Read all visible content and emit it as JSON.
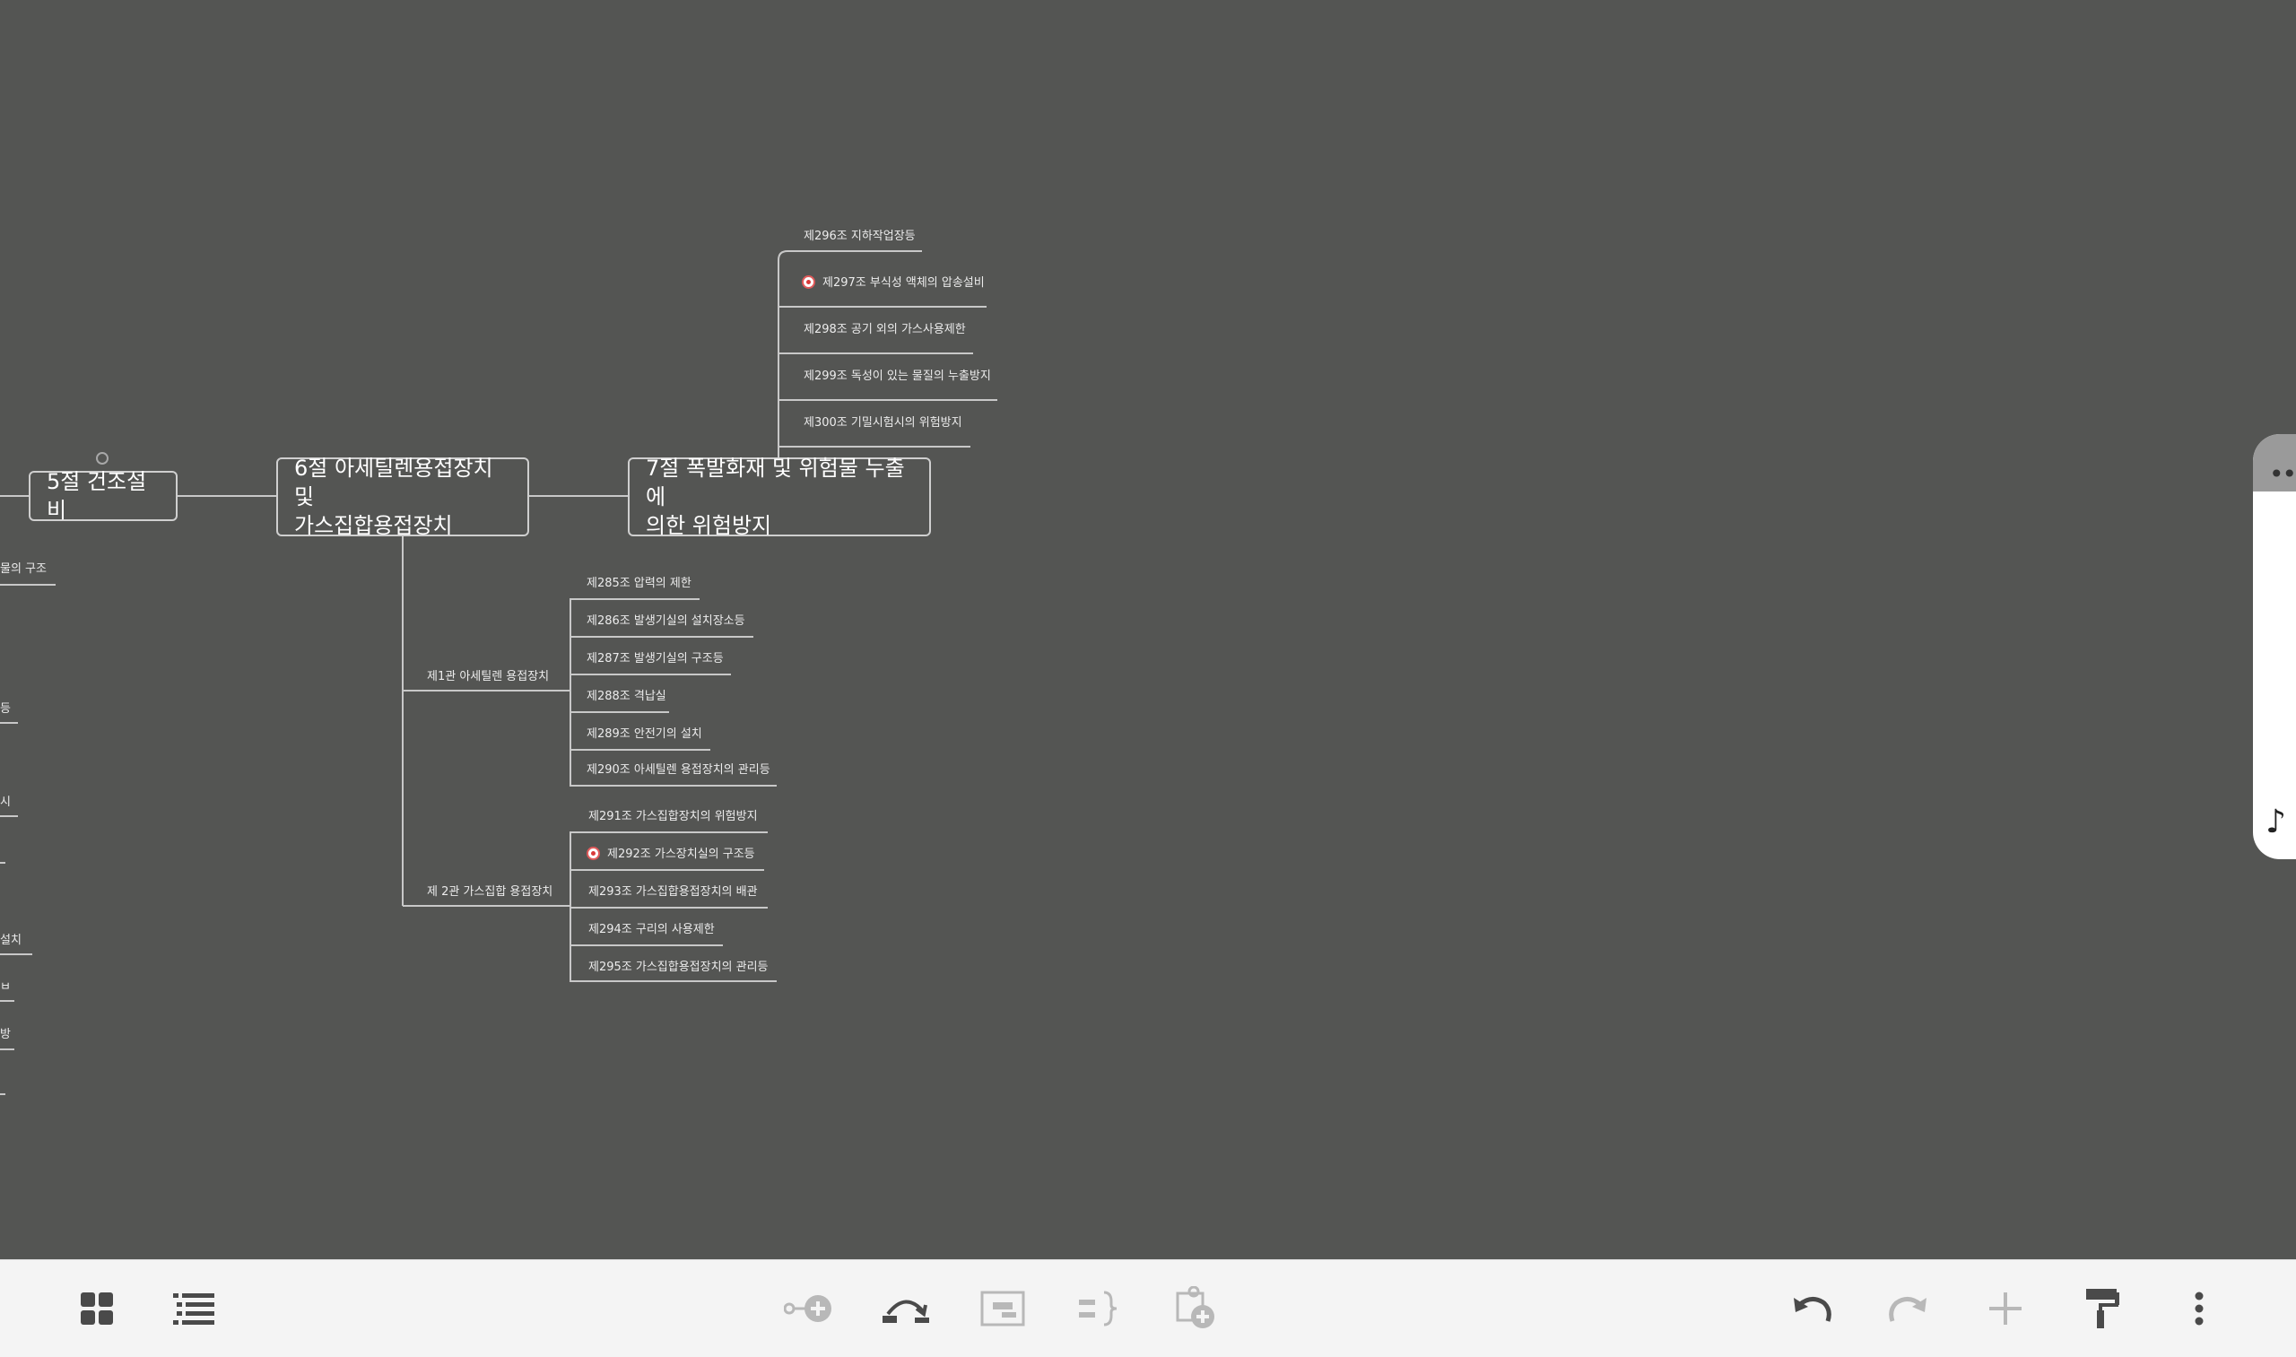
{
  "map": {
    "node5": "5절 건조설비",
    "node6_line1": "6절 아세틸렌용접장치 및",
    "node6_line2": "가스집합용접장치",
    "node7_line1": "7절 폭발화재 및 위험물 누출에",
    "node7_line2": "의한 위험방지",
    "node7_children": [
      "제296조 지하작업장등",
      "제297조 부식성 액체의 압송설비",
      "제298조 공기 외의 가스사용제한",
      "제299조 독성이 있는 물질의 누출방지",
      "제300조 기밀시험시의 위험방지"
    ],
    "sub1_label": "제1관 아세틸렌 용접장치",
    "sub1_children": [
      "제285조 압력의 제한",
      "제286조 발생기실의 설치장소등",
      "제287조 발생기실의 구조등",
      "제288조 격납실",
      "제289조 안전기의 설치",
      "제290조 아세틸렌 용접장치의 관리등"
    ],
    "sub2_label": "제 2관 가스집합 용접장치",
    "sub2_children": [
      "제291조 가스집합장치의 위험방지",
      "제292조 가스장치실의 구조등",
      "제293조 가스집합용접장치의 배관",
      "제294조 구리의 사용제한",
      "제295조 가스집합용접장치의 관리등"
    ],
    "left_fragments": [
      "물의 구조",
      "등",
      "시",
      "설치",
      "ㅂ",
      "방"
    ]
  },
  "toolbar": {
    "left": [
      "grid-view-icon",
      "outline-view-icon"
    ],
    "center": [
      "add-subtopic-icon",
      "relationship-icon",
      "boundary-icon",
      "summary-icon",
      "add-floating-topic-icon"
    ],
    "right": [
      "undo-icon",
      "redo-icon",
      "add-icon",
      "format-painter-icon",
      "more-icon"
    ]
  },
  "colors": {
    "canvas": "#545553",
    "line": "#c8c8c8",
    "toolbar": "#f4f4f4",
    "marker": "#d93a3a"
  }
}
